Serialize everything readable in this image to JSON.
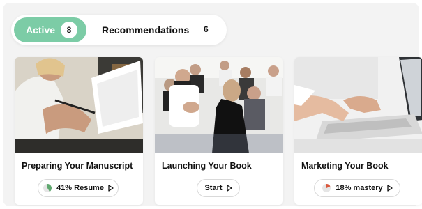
{
  "tabs": [
    {
      "label": "Active",
      "count": "8",
      "selected": true
    },
    {
      "label": "Recommendations",
      "count": "6",
      "selected": false
    }
  ],
  "courses": [
    {
      "title": "Preparing Your Manuscript",
      "action": "41% Resume",
      "progress": 41,
      "icon": "play-icon"
    },
    {
      "title": "Launching Your Book",
      "action": "Start",
      "progress": null,
      "icon": "play-icon"
    },
    {
      "title": "Marketing Your Book",
      "action": "18% mastery",
      "progress": 18,
      "icon": "play-icon"
    }
  ],
  "colors": {
    "accent": "#7ccca6",
    "progress_resume": "#5fa86f",
    "progress_mastery": "#d9573b",
    "track": "#e5e5e5"
  }
}
